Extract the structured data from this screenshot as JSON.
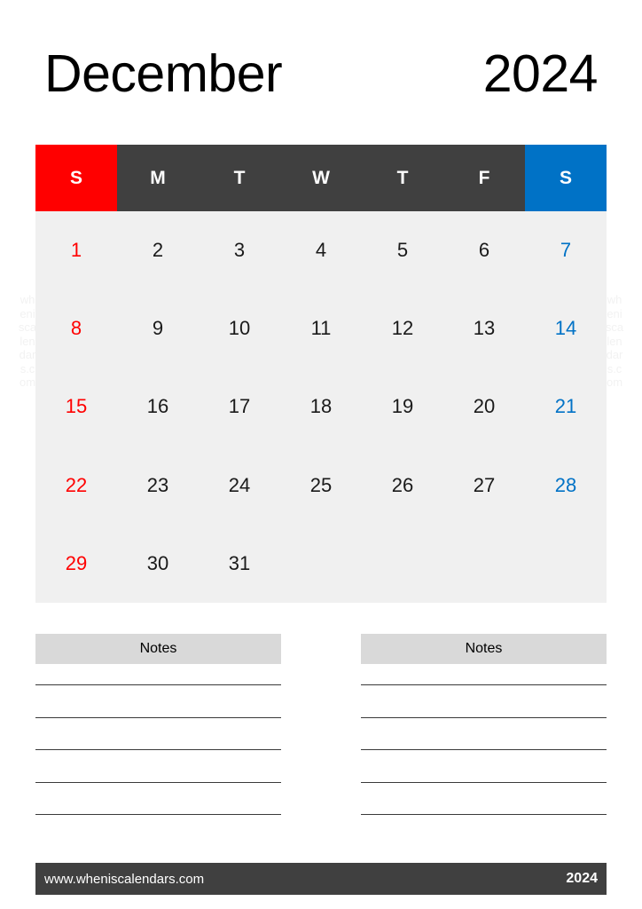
{
  "header": {
    "month": "December",
    "year": "2024"
  },
  "colors": {
    "sunday": "#ff0000",
    "saturday": "#0072c6",
    "weekday_header_bg": "#404040",
    "cell_bg": "#f0f0f0",
    "notes_header_bg": "#d9d9d9",
    "footer_bg": "#404040"
  },
  "watermark": {
    "left": "wheniscalendars.com",
    "right": "wheniscalendars.com"
  },
  "calendar": {
    "day_headers": [
      {
        "label": "S",
        "kind": "sun"
      },
      {
        "label": "M",
        "kind": "weekday"
      },
      {
        "label": "T",
        "kind": "weekday"
      },
      {
        "label": "W",
        "kind": "weekday"
      },
      {
        "label": "T",
        "kind": "weekday"
      },
      {
        "label": "F",
        "kind": "weekday"
      },
      {
        "label": "S",
        "kind": "sat"
      }
    ],
    "weeks": [
      [
        {
          "day": "1",
          "kind": "sun"
        },
        {
          "day": "2",
          "kind": "weekday"
        },
        {
          "day": "3",
          "kind": "weekday"
        },
        {
          "day": "4",
          "kind": "weekday"
        },
        {
          "day": "5",
          "kind": "weekday"
        },
        {
          "day": "6",
          "kind": "weekday"
        },
        {
          "day": "7",
          "kind": "sat"
        }
      ],
      [
        {
          "day": "8",
          "kind": "sun"
        },
        {
          "day": "9",
          "kind": "weekday"
        },
        {
          "day": "10",
          "kind": "weekday"
        },
        {
          "day": "11",
          "kind": "weekday"
        },
        {
          "day": "12",
          "kind": "weekday"
        },
        {
          "day": "13",
          "kind": "weekday"
        },
        {
          "day": "14",
          "kind": "sat"
        }
      ],
      [
        {
          "day": "15",
          "kind": "sun"
        },
        {
          "day": "16",
          "kind": "weekday"
        },
        {
          "day": "17",
          "kind": "weekday"
        },
        {
          "day": "18",
          "kind": "weekday"
        },
        {
          "day": "19",
          "kind": "weekday"
        },
        {
          "day": "20",
          "kind": "weekday"
        },
        {
          "day": "21",
          "kind": "sat"
        }
      ],
      [
        {
          "day": "22",
          "kind": "sun"
        },
        {
          "day": "23",
          "kind": "weekday"
        },
        {
          "day": "24",
          "kind": "weekday"
        },
        {
          "day": "25",
          "kind": "weekday"
        },
        {
          "day": "26",
          "kind": "weekday"
        },
        {
          "day": "27",
          "kind": "weekday"
        },
        {
          "day": "28",
          "kind": "sat"
        }
      ],
      [
        {
          "day": "29",
          "kind": "sun"
        },
        {
          "day": "30",
          "kind": "weekday"
        },
        {
          "day": "31",
          "kind": "weekday"
        },
        {
          "day": "",
          "kind": "empty"
        },
        {
          "day": "",
          "kind": "empty"
        },
        {
          "day": "",
          "kind": "empty"
        },
        {
          "day": "",
          "kind": "empty"
        }
      ]
    ]
  },
  "notes": {
    "columns": [
      {
        "title": "Notes",
        "line_count": 5
      },
      {
        "title": "Notes",
        "line_count": 5
      }
    ]
  },
  "footer": {
    "url": "www.wheniscalendars.com",
    "year": "2024"
  }
}
